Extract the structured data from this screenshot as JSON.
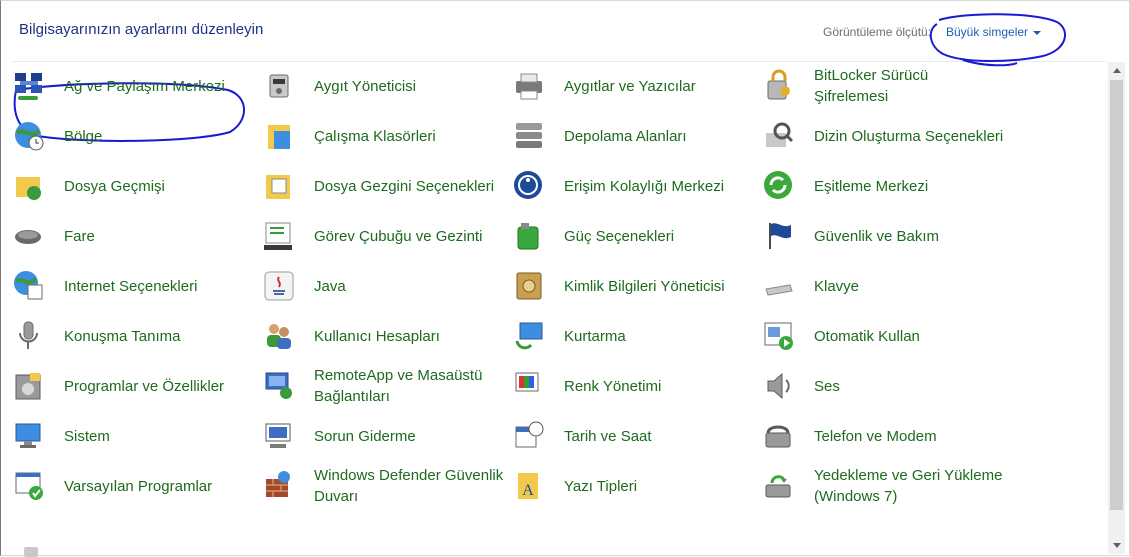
{
  "header": {
    "title": "Bilgisayarınızın ayarlarını düzenleyin"
  },
  "view_by": {
    "label": "Görüntüleme ölçütü:",
    "value": "Büyük simgeler"
  },
  "colors": {
    "link_green": "#1e6a1e",
    "title_blue": "#1e3287",
    "annotation_blue": "#1a1ad0"
  },
  "items": [
    {
      "label": "Ağ ve Paylaşım Merkezi",
      "icon": "network-sharing-icon"
    },
    {
      "label": "Aygıt Yöneticisi",
      "icon": "device-manager-icon"
    },
    {
      "label": "Aygıtlar ve Yazıcılar",
      "icon": "printer-icon"
    },
    {
      "label": "BitLocker Sürücü Şifrelemesi",
      "icon": "bitlocker-lock-icon"
    },
    {
      "label": "Bölge",
      "icon": "globe-clock-icon"
    },
    {
      "label": "Çalışma Klasörleri",
      "icon": "work-folders-icon"
    },
    {
      "label": "Depolama Alanları",
      "icon": "storage-spaces-icon"
    },
    {
      "label": "Dizin Oluşturma Seçenekleri",
      "icon": "indexing-search-icon"
    },
    {
      "label": "Dosya Geçmişi",
      "icon": "file-history-icon"
    },
    {
      "label": "Dosya Gezgini Seçenekleri",
      "icon": "folder-options-icon"
    },
    {
      "label": "Erişim Kolaylığı Merkezi",
      "icon": "ease-of-access-icon"
    },
    {
      "label": "Eşitleme Merkezi",
      "icon": "sync-center-icon"
    },
    {
      "label": "Fare",
      "icon": "mouse-icon"
    },
    {
      "label": "Görev Çubuğu ve Gezinti",
      "icon": "taskbar-icon"
    },
    {
      "label": "Güç Seçenekleri",
      "icon": "power-options-icon"
    },
    {
      "label": "Güvenlik ve Bakım",
      "icon": "security-flag-icon"
    },
    {
      "label": "Internet Seçenekleri",
      "icon": "internet-options-icon"
    },
    {
      "label": "Java",
      "icon": "java-icon"
    },
    {
      "label": "Kimlik Bilgileri Yöneticisi",
      "icon": "credential-vault-icon"
    },
    {
      "label": "Klavye",
      "icon": "keyboard-icon"
    },
    {
      "label": "Konuşma Tanıma",
      "icon": "microphone-icon"
    },
    {
      "label": "Kullanıcı Hesapları",
      "icon": "user-accounts-icon"
    },
    {
      "label": "Kurtarma",
      "icon": "recovery-icon"
    },
    {
      "label": "Otomatik Kullan",
      "icon": "autoplay-icon"
    },
    {
      "label": "Programlar ve Özellikler",
      "icon": "programs-features-icon"
    },
    {
      "label": "RemoteApp ve Masaüstü Bağlantıları",
      "icon": "remoteapp-icon"
    },
    {
      "label": "Renk Yönetimi",
      "icon": "color-management-icon"
    },
    {
      "label": "Ses",
      "icon": "speaker-icon"
    },
    {
      "label": "Sistem",
      "icon": "system-computer-icon"
    },
    {
      "label": "Sorun Giderme",
      "icon": "troubleshooting-icon"
    },
    {
      "label": "Tarih ve Saat",
      "icon": "calendar-clock-icon"
    },
    {
      "label": "Telefon ve Modem",
      "icon": "phone-modem-icon"
    },
    {
      "label": "Varsayılan Programlar",
      "icon": "default-programs-icon"
    },
    {
      "label": "Windows Defender Güvenlik Duvarı",
      "icon": "firewall-icon"
    },
    {
      "label": "Yazı Tipleri",
      "icon": "fonts-folder-icon"
    },
    {
      "label": "Yedekleme ve Geri Yükleme (Windows 7)",
      "icon": "backup-restore-icon"
    }
  ]
}
